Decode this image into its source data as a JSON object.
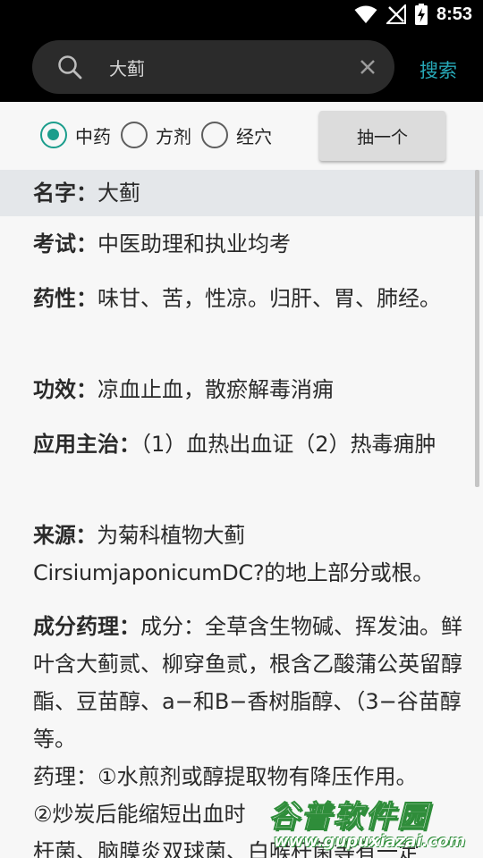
{
  "status_bar": {
    "time": "8:53"
  },
  "search": {
    "query": "大蓟",
    "button_label": "搜索"
  },
  "filters": {
    "options": [
      {
        "label": "中药",
        "checked": true
      },
      {
        "label": "方剂",
        "checked": false
      },
      {
        "label": "经穴",
        "checked": false
      }
    ],
    "draw_button": "抽一个"
  },
  "entries": [
    {
      "key": "名字：",
      "value": "大蓟"
    },
    {
      "key": "考试：",
      "value": "中医助理和执业均考"
    },
    {
      "key": "药性：",
      "value": "味甘、苦，性凉。归肝、胃、肺经。"
    },
    {
      "key": "功效：",
      "value": "凉血止血，散瘀解毒消痈"
    },
    {
      "key": "应用主治：",
      "value": "（1）血热出血证（2）热毒痈肿"
    },
    {
      "key": "来源：",
      "value": "为菊科植物大蓟CirsiumjaponicumDC?的地上部分或根。"
    },
    {
      "key": "成分药理：",
      "value": "成分：全草含生物碱、挥发油。鲜叶含大蓟贰、柳穿鱼贰，根含乙酸蒲公英留醇酯、豆苗醇、a−和B−香树脂醇、（3−谷苗醇等。"
    }
  ],
  "pharmacology_lines": [
    "药理：①水煎剂或醇提取物有降压作用。",
    "②炒炭后能缩短出血时",
    "杆菌、脑膜炎双球菌、白喉杆菌等有一定"
  ],
  "watermark": {
    "title": "谷普软件园",
    "url": "www.gupuxiazai.com"
  }
}
